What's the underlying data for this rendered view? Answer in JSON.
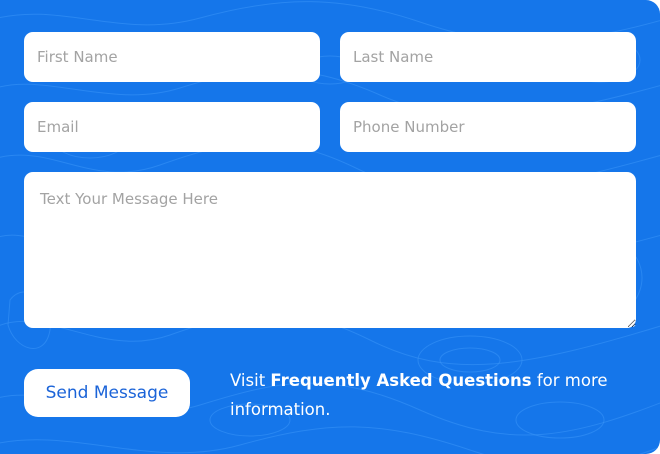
{
  "form": {
    "first_name_placeholder": "First Name",
    "last_name_placeholder": "Last Name",
    "email_placeholder": "Email",
    "phone_placeholder": "Phone Number",
    "message_placeholder": "Text Your Message Here",
    "send_label": "Send Message"
  },
  "faq": {
    "prefix": "Visit ",
    "link_text": "Frequently Asked Questions",
    "suffix": " for more information."
  },
  "colors": {
    "background": "#1576ea",
    "field": "#ffffff",
    "button_text": "#1a63d8",
    "placeholder": "#a3a3a3"
  }
}
